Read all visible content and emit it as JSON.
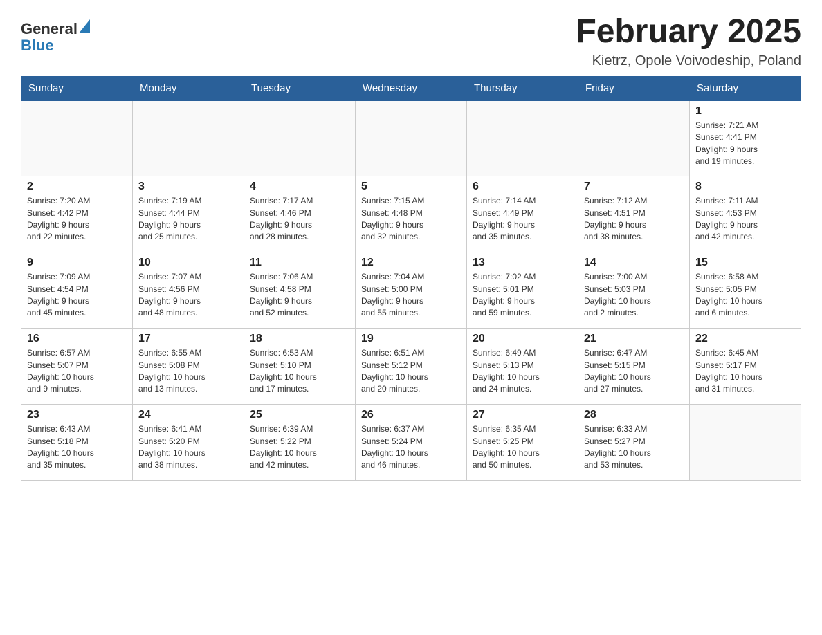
{
  "header": {
    "logo_line1": "General",
    "logo_line2": "Blue",
    "month_title": "February 2025",
    "location": "Kietrz, Opole Voivodeship, Poland"
  },
  "weekdays": [
    "Sunday",
    "Monday",
    "Tuesday",
    "Wednesday",
    "Thursday",
    "Friday",
    "Saturday"
  ],
  "weeks": [
    [
      {
        "day": "",
        "info": ""
      },
      {
        "day": "",
        "info": ""
      },
      {
        "day": "",
        "info": ""
      },
      {
        "day": "",
        "info": ""
      },
      {
        "day": "",
        "info": ""
      },
      {
        "day": "",
        "info": ""
      },
      {
        "day": "1",
        "info": "Sunrise: 7:21 AM\nSunset: 4:41 PM\nDaylight: 9 hours\nand 19 minutes."
      }
    ],
    [
      {
        "day": "2",
        "info": "Sunrise: 7:20 AM\nSunset: 4:42 PM\nDaylight: 9 hours\nand 22 minutes."
      },
      {
        "day": "3",
        "info": "Sunrise: 7:19 AM\nSunset: 4:44 PM\nDaylight: 9 hours\nand 25 minutes."
      },
      {
        "day": "4",
        "info": "Sunrise: 7:17 AM\nSunset: 4:46 PM\nDaylight: 9 hours\nand 28 minutes."
      },
      {
        "day": "5",
        "info": "Sunrise: 7:15 AM\nSunset: 4:48 PM\nDaylight: 9 hours\nand 32 minutes."
      },
      {
        "day": "6",
        "info": "Sunrise: 7:14 AM\nSunset: 4:49 PM\nDaylight: 9 hours\nand 35 minutes."
      },
      {
        "day": "7",
        "info": "Sunrise: 7:12 AM\nSunset: 4:51 PM\nDaylight: 9 hours\nand 38 minutes."
      },
      {
        "day": "8",
        "info": "Sunrise: 7:11 AM\nSunset: 4:53 PM\nDaylight: 9 hours\nand 42 minutes."
      }
    ],
    [
      {
        "day": "9",
        "info": "Sunrise: 7:09 AM\nSunset: 4:54 PM\nDaylight: 9 hours\nand 45 minutes."
      },
      {
        "day": "10",
        "info": "Sunrise: 7:07 AM\nSunset: 4:56 PM\nDaylight: 9 hours\nand 48 minutes."
      },
      {
        "day": "11",
        "info": "Sunrise: 7:06 AM\nSunset: 4:58 PM\nDaylight: 9 hours\nand 52 minutes."
      },
      {
        "day": "12",
        "info": "Sunrise: 7:04 AM\nSunset: 5:00 PM\nDaylight: 9 hours\nand 55 minutes."
      },
      {
        "day": "13",
        "info": "Sunrise: 7:02 AM\nSunset: 5:01 PM\nDaylight: 9 hours\nand 59 minutes."
      },
      {
        "day": "14",
        "info": "Sunrise: 7:00 AM\nSunset: 5:03 PM\nDaylight: 10 hours\nand 2 minutes."
      },
      {
        "day": "15",
        "info": "Sunrise: 6:58 AM\nSunset: 5:05 PM\nDaylight: 10 hours\nand 6 minutes."
      }
    ],
    [
      {
        "day": "16",
        "info": "Sunrise: 6:57 AM\nSunset: 5:07 PM\nDaylight: 10 hours\nand 9 minutes."
      },
      {
        "day": "17",
        "info": "Sunrise: 6:55 AM\nSunset: 5:08 PM\nDaylight: 10 hours\nand 13 minutes."
      },
      {
        "day": "18",
        "info": "Sunrise: 6:53 AM\nSunset: 5:10 PM\nDaylight: 10 hours\nand 17 minutes."
      },
      {
        "day": "19",
        "info": "Sunrise: 6:51 AM\nSunset: 5:12 PM\nDaylight: 10 hours\nand 20 minutes."
      },
      {
        "day": "20",
        "info": "Sunrise: 6:49 AM\nSunset: 5:13 PM\nDaylight: 10 hours\nand 24 minutes."
      },
      {
        "day": "21",
        "info": "Sunrise: 6:47 AM\nSunset: 5:15 PM\nDaylight: 10 hours\nand 27 minutes."
      },
      {
        "day": "22",
        "info": "Sunrise: 6:45 AM\nSunset: 5:17 PM\nDaylight: 10 hours\nand 31 minutes."
      }
    ],
    [
      {
        "day": "23",
        "info": "Sunrise: 6:43 AM\nSunset: 5:18 PM\nDaylight: 10 hours\nand 35 minutes."
      },
      {
        "day": "24",
        "info": "Sunrise: 6:41 AM\nSunset: 5:20 PM\nDaylight: 10 hours\nand 38 minutes."
      },
      {
        "day": "25",
        "info": "Sunrise: 6:39 AM\nSunset: 5:22 PM\nDaylight: 10 hours\nand 42 minutes."
      },
      {
        "day": "26",
        "info": "Sunrise: 6:37 AM\nSunset: 5:24 PM\nDaylight: 10 hours\nand 46 minutes."
      },
      {
        "day": "27",
        "info": "Sunrise: 6:35 AM\nSunset: 5:25 PM\nDaylight: 10 hours\nand 50 minutes."
      },
      {
        "day": "28",
        "info": "Sunrise: 6:33 AM\nSunset: 5:27 PM\nDaylight: 10 hours\nand 53 minutes."
      },
      {
        "day": "",
        "info": ""
      }
    ]
  ]
}
